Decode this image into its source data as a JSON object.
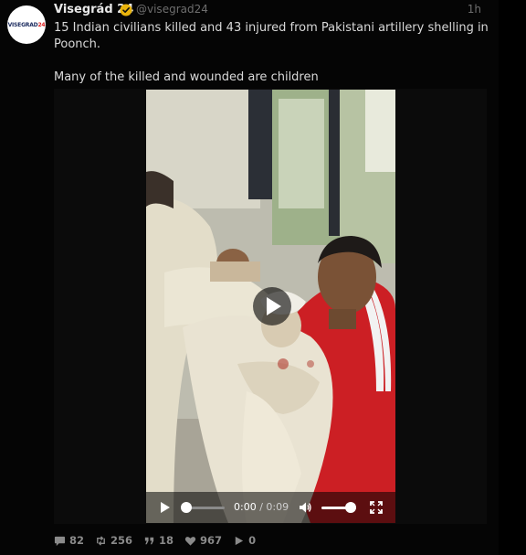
{
  "tweet": {
    "author_name": "Visegrád 24",
    "handle": "@visegrad24",
    "time": "1h",
    "avatar_text": "VISEGRAD",
    "avatar_text_num": "24",
    "text_line1": "15 Indian civilians killed and 43 injured from Pakistani artillery shelling in Poonch.",
    "text_line2": "Many of the killed and wounded are children"
  },
  "video": {
    "current_time": "0:00",
    "separator": " / ",
    "duration": "0:09",
    "progress": 0.0,
    "volume": 0.85
  },
  "stats": {
    "replies": "82",
    "retweets": "256",
    "quotes": "18",
    "likes": "967",
    "views": "0"
  },
  "colors": {
    "background": "#050505",
    "text": "#d9d9d9",
    "muted": "#6e6e6e",
    "verified": "#e8b30c"
  }
}
